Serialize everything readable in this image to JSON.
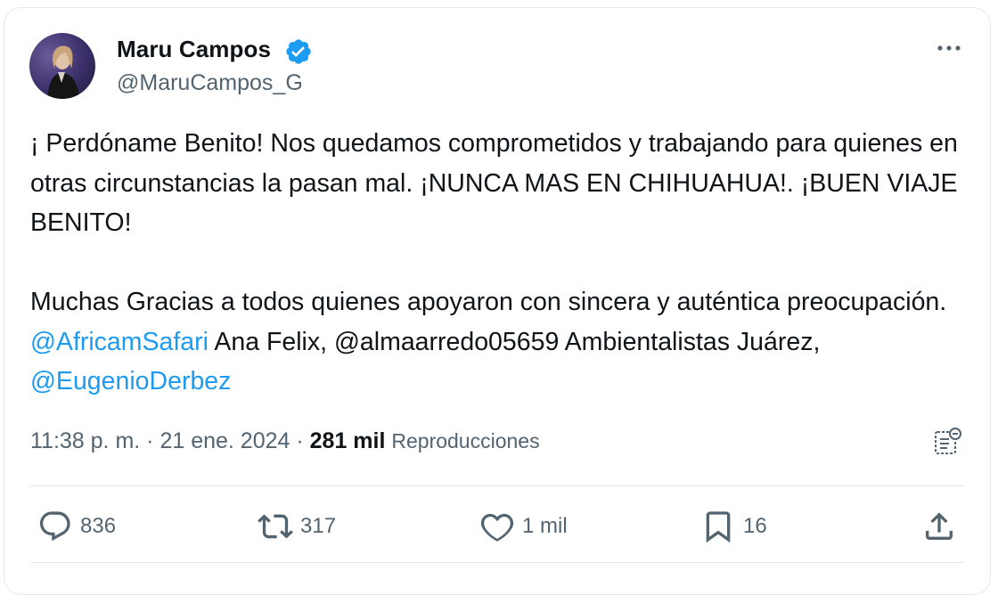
{
  "tweet": {
    "author": {
      "name": "Maru Campos",
      "handle": "@MaruCampos_G",
      "verified": true
    },
    "text": {
      "p1": "¡ Perdóname Benito!  Nos quedamos comprometidos y trabajando para quienes en otras circunstancias la pasan mal. ¡NUNCA MAS EN CHIHUAHUA!. ¡BUEN VIAJE BENITO!",
      "p2_start": "Muchas Gracias  a todos quienes apoyaron con sincera y auténtica preocupación. ",
      "mention1": "@AfricamSafari",
      "p2_mid1": " Ana Felix, @almaarredo05659 Ambientalistas Juárez, ",
      "mention2": "@EugenioDerbez"
    },
    "meta": {
      "time": "11:38 p. m.",
      "sep1": " · ",
      "date": "21 ene. 2024",
      "sep2": " · ",
      "views_count": "281 mil",
      "views_label": "Reproducciones"
    },
    "actions": {
      "replies": "836",
      "retweets": "317",
      "likes": "1 mil",
      "bookmarks": "16"
    }
  },
  "colors": {
    "text": "#0f1419",
    "secondary": "#536471",
    "accent": "#1d9bf0",
    "border": "#e6e9ec"
  },
  "icons": [
    "verified-badge-icon",
    "more-icon",
    "analytics-icon",
    "reply-icon",
    "retweet-icon",
    "like-icon",
    "bookmark-icon",
    "share-icon"
  ]
}
